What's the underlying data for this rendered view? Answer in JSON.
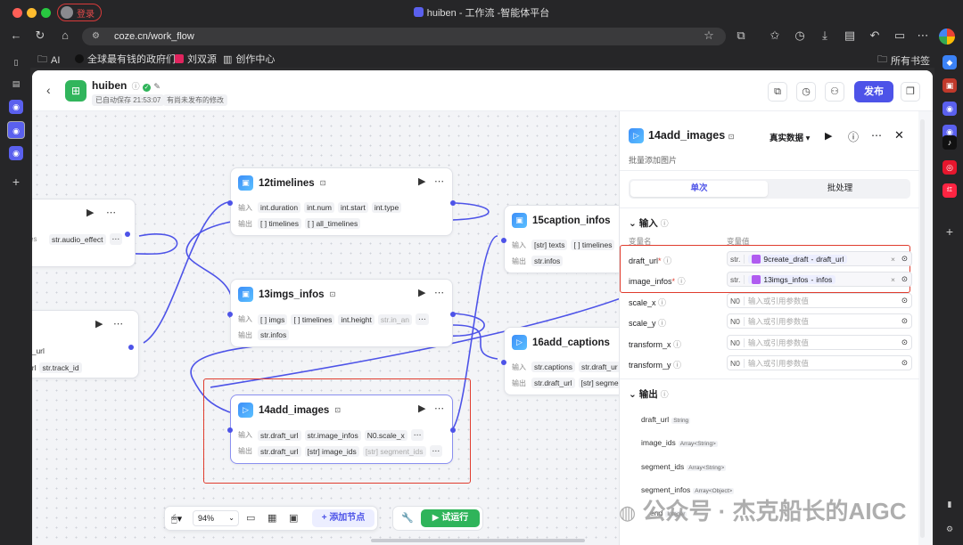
{
  "browser": {
    "login_label": "登录",
    "window_title": "huiben - 工作流 -智能体平台",
    "url": "coze.cn/work_flow",
    "bookmarks": [
      "AI",
      "全球最有钱的政府们...",
      "刘双源",
      "创作中心"
    ],
    "all_bookmarks": "所有书签"
  },
  "header": {
    "title": "huiben",
    "autosave": "已自动保存 21:53:07",
    "unpublished": "有尚未发布的修改",
    "publish_label": "发布"
  },
  "canvas": {
    "in_label": "输入",
    "out_label": "输出",
    "nodes": {
      "n11": {
        "in": [
          "str.audio_effect"
        ]
      },
      "n10": {
        "in": [
          "ft_url"
        ],
        "out": [
          "url",
          "str.track_id"
        ]
      },
      "n12": {
        "name": "12timelines",
        "in": [
          "int.duration",
          "int.num",
          "int.start",
          "int.type"
        ],
        "out": [
          "[ ] timelines",
          "[ ] all_timelines"
        ]
      },
      "n13": {
        "name": "13imgs_infos",
        "in": [
          "[ ] imgs",
          "[ ] timelines",
          "int.height",
          "str.in_an"
        ],
        "out": [
          "str.infos"
        ]
      },
      "n14": {
        "name": "14add_images",
        "in": [
          "str.draft_url",
          "str.image_infos",
          "N0.scale_x"
        ],
        "out": [
          "str.draft_url",
          "[str] image_ids",
          "[str] segment_ids"
        ]
      },
      "n15": {
        "name": "15caption_infos",
        "in": [
          "[str] texts",
          "[ ] timelines"
        ],
        "out": [
          "str.infos"
        ]
      },
      "n16": {
        "name": "16add_captions",
        "in": [
          "str.captions",
          "str.draft_ur"
        ],
        "out": [
          "str.draft_url",
          "[str] segmen"
        ]
      }
    }
  },
  "toolbar": {
    "zoom": "94%",
    "add_node": "添加节点",
    "test_run": "试运行"
  },
  "panel": {
    "title": "14add_images",
    "desc": "批量添加图片",
    "data_mode": "真实数据",
    "tabs": [
      "单次",
      "批处理"
    ],
    "input_title": "输入",
    "col_var": "变量名",
    "col_val": "变量值",
    "inputs": [
      {
        "name": "draft_url",
        "required": true,
        "type": "str.",
        "ref_node": "9create_draft",
        "ref_var": "draft_url"
      },
      {
        "name": "image_infos",
        "required": true,
        "type": "str.",
        "ref_node": "13imgs_infos",
        "ref_var": "infos"
      },
      {
        "name": "scale_x",
        "type": "N0",
        "placeholder": "输入或引用参数值"
      },
      {
        "name": "scale_y",
        "type": "N0",
        "placeholder": "输入或引用参数值"
      },
      {
        "name": "transform_x",
        "type": "N0",
        "placeholder": "输入或引用参数值"
      },
      {
        "name": "transform_y",
        "type": "N0",
        "placeholder": "输入或引用参数值"
      }
    ],
    "output_title": "输出",
    "outputs": [
      {
        "name": "draft_url",
        "type": "String"
      },
      {
        "name": "image_ids",
        "type": "Array<String>"
      },
      {
        "name": "segment_ids",
        "type": "Array<String>"
      },
      {
        "name": "segment_infos",
        "type": "Array<Object>"
      },
      {
        "name": "end",
        "type": "Integer"
      }
    ]
  },
  "watermark": "公众号 · 杰克船长的AIGC",
  "colors": {
    "accent": "#4d53e8",
    "highlight": "#e03c2e",
    "success": "#2fb45a"
  }
}
